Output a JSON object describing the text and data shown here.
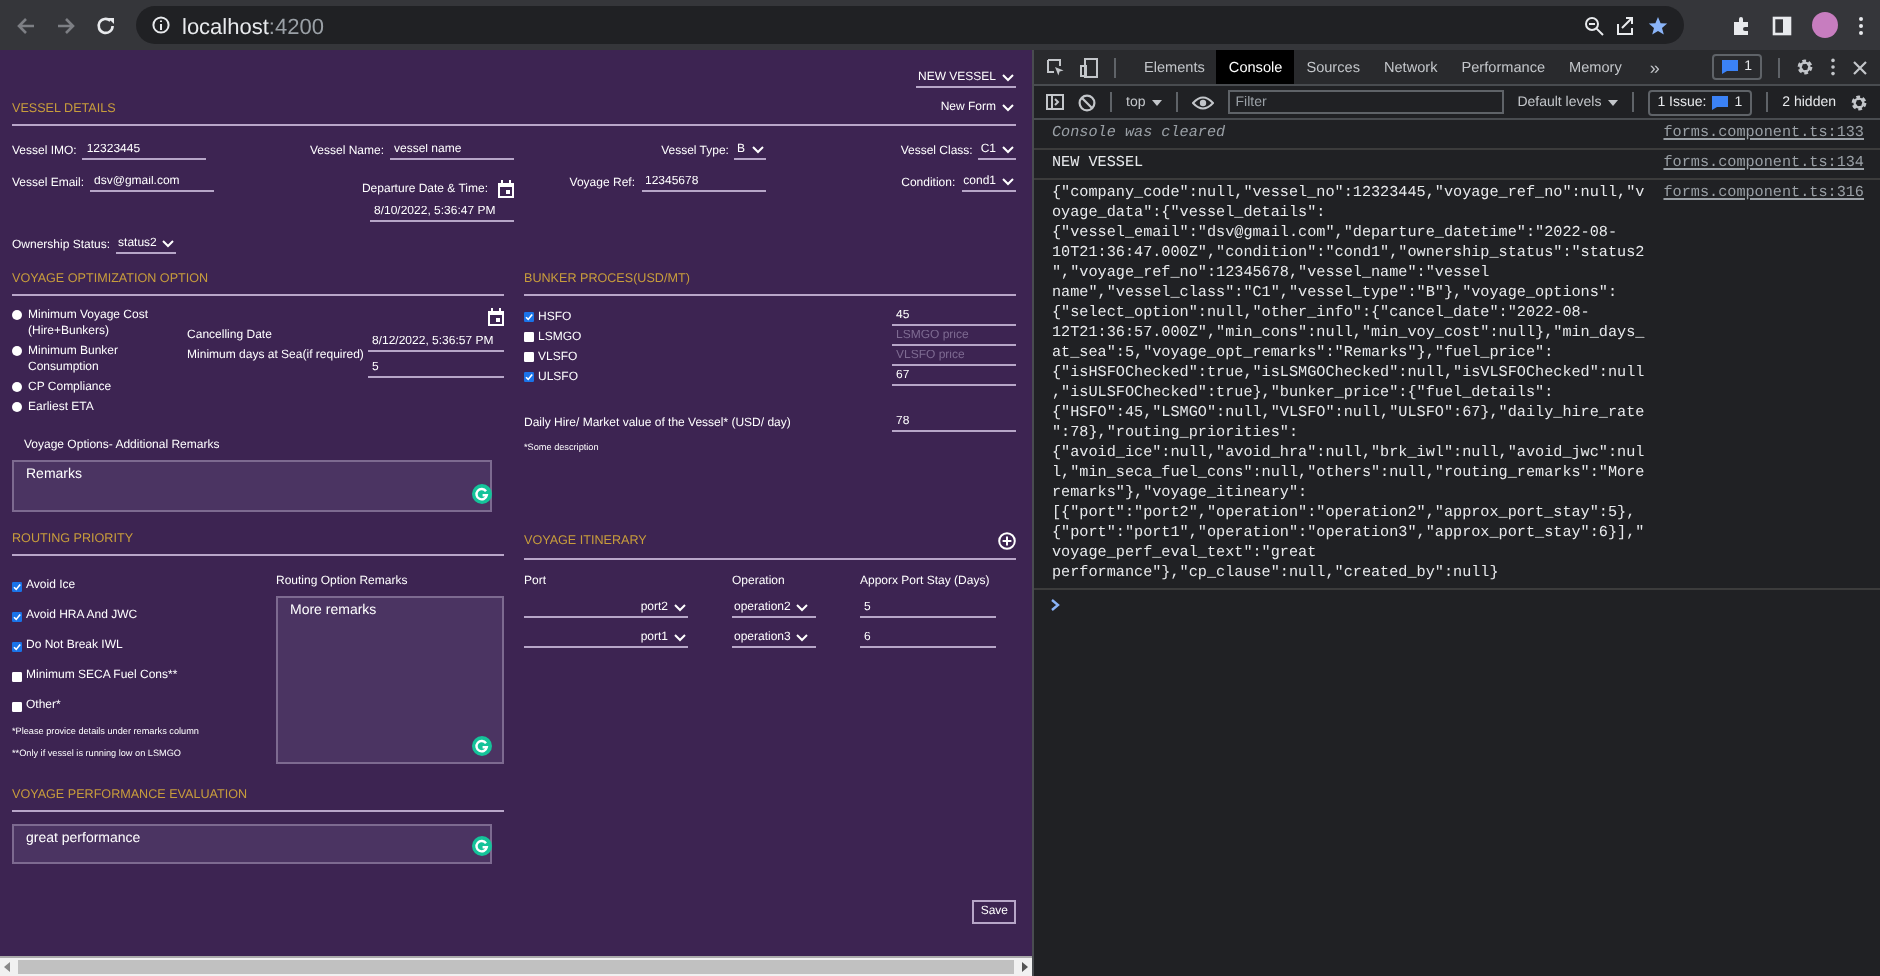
{
  "browser": {
    "url_host": "localhost",
    "url_port": ":4200"
  },
  "form": {
    "mode_select": "NEW VESSEL",
    "vessel_details": {
      "title": "VESSEL DETAILS",
      "form_select": "New Form",
      "fields": [
        {
          "label": "Vessel IMO:",
          "value": "12323445",
          "kind": "text"
        },
        {
          "label": "Vessel Name:",
          "value": "vessel name",
          "kind": "text"
        },
        {
          "label": "Vessel Type:",
          "value": "B",
          "kind": "select"
        },
        {
          "label": "Vessel Class:",
          "value": "C1",
          "kind": "select"
        },
        {
          "label": "Vessel Email:",
          "value": "dsv@gmail.com",
          "kind": "text"
        },
        {
          "label": "Departure Date & Time:",
          "value": "8/10/2022, 5:36:47 PM",
          "kind": "date"
        },
        {
          "label": "Voyage Ref:",
          "value": "12345678",
          "kind": "text"
        },
        {
          "label": "Condition:",
          "value": "cond1",
          "kind": "select"
        },
        {
          "label": "Ownership Status:",
          "value": "status2",
          "kind": "select"
        }
      ]
    },
    "voyage_optimization": {
      "title": "VOYAGE OPTIMIZATION OPTION",
      "options": [
        {
          "label": "Minimum Voyage Cost (Hire+Bunkers)",
          "selected": false
        },
        {
          "label": "Minimum Bunker Consumption",
          "selected": false
        },
        {
          "label": "CP Compliance",
          "selected": false
        },
        {
          "label": "Earliest ETA",
          "selected": false
        }
      ],
      "cancelling_date_label": "Cancelling Date",
      "cancelling_date": "8/12/2022, 5:36:57 PM",
      "min_days_label": "Minimum days at Sea(if required)",
      "min_days": "5",
      "remarks_label": "Voyage Options- Additional Remarks",
      "remarks": "Remarks"
    },
    "bunker_prices": {
      "title": "BUNKER PROCES(USD/MT)",
      "fuels": [
        {
          "name": "HSFO",
          "checked": true,
          "value": "45"
        },
        {
          "name": "LSMGO",
          "checked": false,
          "placeholder": "LSMGO price"
        },
        {
          "name": "VLSFO",
          "checked": false,
          "placeholder": "VLSFO price"
        },
        {
          "name": "ULSFO",
          "checked": true,
          "value": "67"
        }
      ],
      "daily_hire_label": "Daily Hire/ Market value of the Vessel* (USD/ day)",
      "daily_hire": "78",
      "note": "*Some description"
    },
    "routing_priority": {
      "title": "ROUTING PRIORITY",
      "options": [
        {
          "label": "Avoid Ice",
          "checked": true
        },
        {
          "label": "Avoid HRA And JWC",
          "checked": true
        },
        {
          "label": "Do Not Break IWL",
          "checked": true
        },
        {
          "label": "Minimum SECA Fuel Cons**",
          "checked": false
        },
        {
          "label": "Other*",
          "checked": false
        }
      ],
      "notes": [
        "*Please provice details under remarks column",
        "**Only if vessel is running low on LSMGO"
      ],
      "remarks_label": "Routing Option Remarks",
      "remarks": "More remarks"
    },
    "voyage_itinerary": {
      "title": "VOYAGE ITINERARY",
      "columns": [
        "Port",
        "Operation",
        "Apporx Port Stay (Days)"
      ],
      "rows": [
        {
          "port": "port2",
          "operation": "operation2",
          "stay": "5"
        },
        {
          "port": "port1",
          "operation": "operation3",
          "stay": "6"
        }
      ]
    },
    "performance": {
      "title": "VOYAGE PERFORMANCE EVALUATION",
      "text": "great performance"
    },
    "save_button": "Save"
  },
  "devtools": {
    "tabs": [
      {
        "label": "Elements",
        "selected": false
      },
      {
        "label": "Console",
        "selected": true
      },
      {
        "label": "Sources",
        "selected": false
      },
      {
        "label": "Network",
        "selected": false
      },
      {
        "label": "Performance",
        "selected": false
      },
      {
        "label": "Memory",
        "selected": false
      }
    ],
    "overflow": "»",
    "message_count": "1",
    "context": "top",
    "filter_placeholder": "Filter",
    "levels": "Default levels",
    "issues_label": "1 Issue:",
    "issues_count": "1",
    "hidden": "2 hidden",
    "messages": [
      {
        "kind": "info",
        "text": "Console was cleared",
        "source": "forms.component.ts:133"
      },
      {
        "kind": "log",
        "text": "NEW VESSEL",
        "source": "forms.component.ts:134"
      },
      {
        "kind": "log",
        "text": "{\"company_code\":null,\"vessel_no\":12323445,\"voyage_ref_no\":null,\"voyage_data\":{\"vessel_details\":{\"vessel_email\":\"dsv@gmail.com\",\"departure_datetime\":\"2022-08-10T21:36:47.000Z\",\"condition\":\"cond1\",\"ownership_status\":\"status2\",\"voyage_ref_no\":12345678,\"vessel_name\":\"vessel name\",\"vessel_class\":\"C1\",\"vessel_type\":\"B\"},\"voyage_options\":{\"select_option\":null,\"other_info\":{\"cancel_date\":\"2022-08-12T21:36:57.000Z\",\"min_cons\":null,\"min_voy_cost\":null},\"min_days_at_sea\":5,\"voyage_opt_remarks\":\"Remarks\"},\"fuel_price\":{\"isHSFOChecked\":true,\"isLSMGOChecked\":null,\"isVLSFOChecked\":null,\"isULSFOChecked\":true},\"bunker_price\":{\"fuel_details\":{\"HSFO\":45,\"LSMGO\":null,\"VLSFO\":null,\"ULSFO\":67},\"daily_hire_rate\":78},\"routing_priorities\":{\"avoid_ice\":null,\"avoid_hra\":null,\"brk_iwl\":null,\"avoid_jwc\":null,\"min_seca_fuel_cons\":null,\"others\":null,\"routing_remarks\":\"More remarks\"},\"voyage_itineary\":[{\"port\":\"port2\",\"operation\":\"operation2\",\"approx_port_stay\":5},{\"port\":\"port1\",\"operation\":\"operation3\",\"approx_port_stay\":6}],\"voyage_perf_eval_text\":\"great performance\"},\"cp_clause\":null,\"created_by\":null}",
        "source": "forms.component.ts:316"
      }
    ]
  }
}
